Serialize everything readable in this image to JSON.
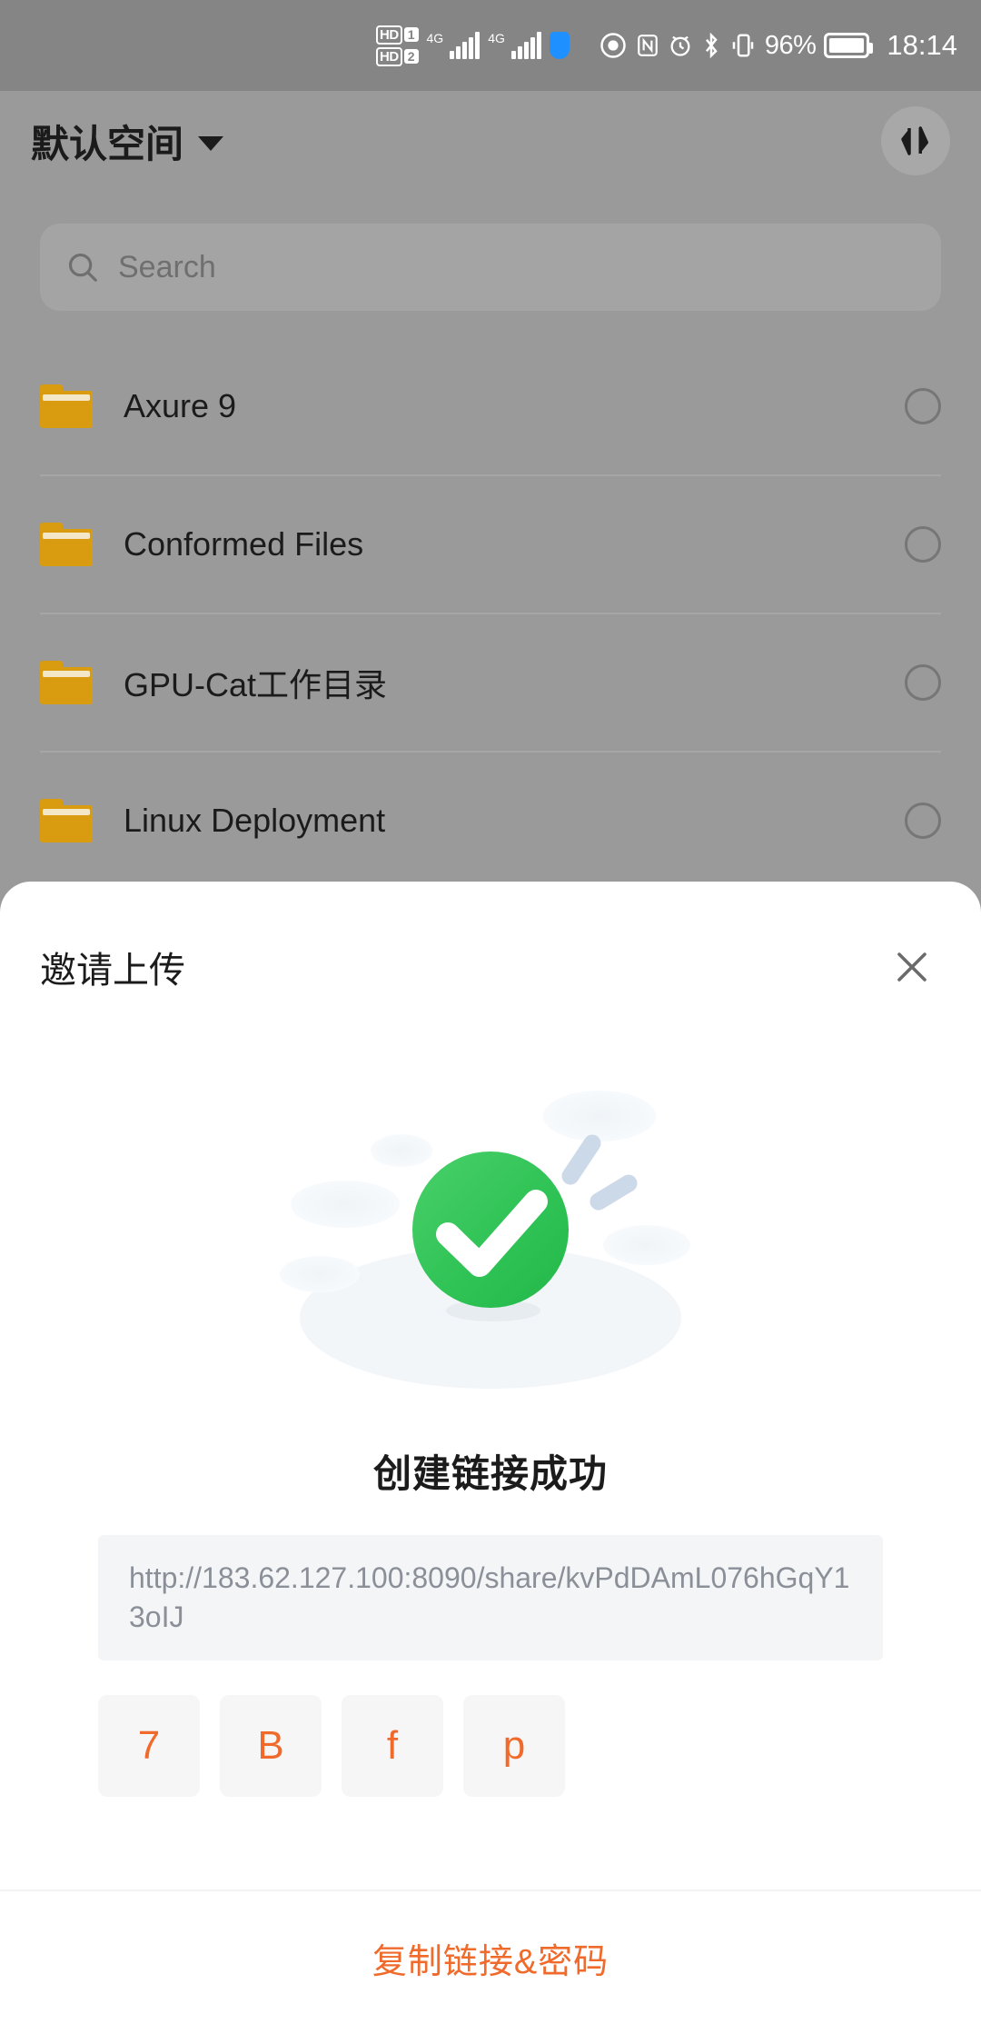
{
  "status_bar": {
    "sim1_hd": "HD",
    "sim1_num": "1",
    "sim2_hd": "HD",
    "sim2_num": "2",
    "net1": "4G",
    "net2": "4G",
    "battery_percent": "96%",
    "time": "18:14",
    "icons": [
      "hd-sim-icon",
      "signal-bars-icon",
      "shield-icon",
      "eye-icon",
      "nfc-icon",
      "alarm-icon",
      "bluetooth-icon",
      "vibrate-icon",
      "battery-icon"
    ]
  },
  "header": {
    "space_name": "默认空间",
    "dropdown_icon": "chevron-down-icon",
    "sort_icon": "sort-arrows-icon"
  },
  "search": {
    "placeholder": "Search",
    "icon": "search-icon"
  },
  "file_list": {
    "items": [
      {
        "name": "Axure 9",
        "icon": "folder-icon",
        "selected": false
      },
      {
        "name": "Conformed Files",
        "icon": "folder-icon",
        "selected": false
      },
      {
        "name": "GPU-Cat工作目录",
        "icon": "folder-icon",
        "selected": false
      },
      {
        "name": "Linux Deployment",
        "icon": "folder-icon",
        "selected": false
      }
    ]
  },
  "sheet": {
    "title": "邀请上传",
    "close_icon": "close-icon",
    "illustration": "success-check-icon",
    "success_text": "创建链接成功",
    "share_url": "http://183.62.127.100:8090/share/kvPdDAmL076hGqY13oIJ",
    "password_chars": [
      "7",
      "B",
      "f",
      "p"
    ],
    "copy_label": "复制链接&密码"
  },
  "colors": {
    "accent_orange": "#ef6a2b",
    "success_green": "#34c759",
    "folder_amber": "#d99b10",
    "scrim": "#9a9a9a",
    "sheet_bg": "#ffffff",
    "url_bg": "#f4f5f7"
  }
}
